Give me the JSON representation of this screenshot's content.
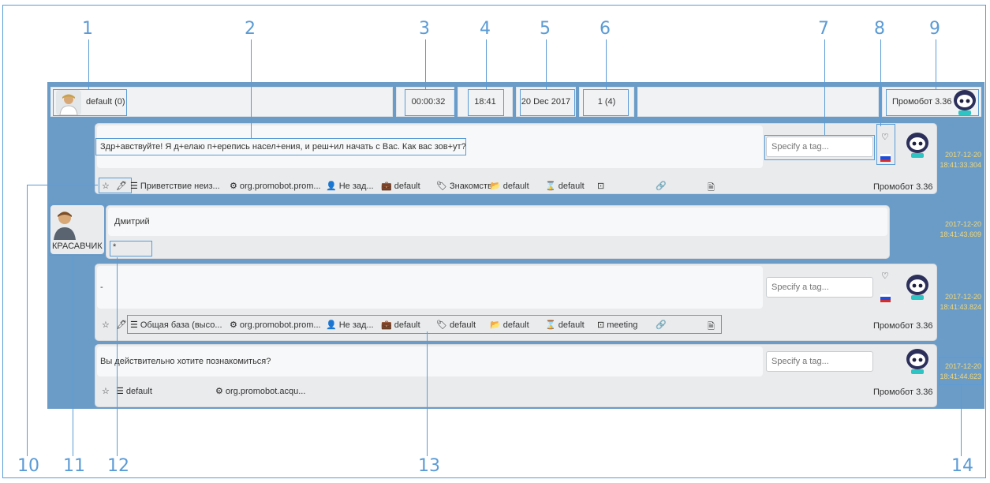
{
  "callouts": [
    "1",
    "2",
    "3",
    "4",
    "5",
    "6",
    "7",
    "8",
    "9",
    "10",
    "11",
    "12",
    "13",
    "14"
  ],
  "topbar": {
    "user_label": "default (0)",
    "timer": "00:00:32",
    "time": "18:41",
    "date": "20 Dec 2017",
    "counter": "1 (4)",
    "bot_name": "Промобот 3.36"
  },
  "messages": [
    {
      "text": "Здр+авствуйте! Я д+елаю п+ерепись насел+ения, и реш+ил начать с Вас. Как вас зов+ут?",
      "tag_placeholder": "Specify a tag...",
      "author": "Промобот 3.36",
      "date": "2017-12-20",
      "time": "18:41:33.304",
      "tools": {
        "category": "Приветствие неиз...",
        "plugin": "org.promobot.prom...",
        "person": "Не зад...",
        "bag": "default",
        "tag": "Знакомств",
        "folder": "default",
        "timer": "default",
        "file": ""
      }
    },
    {
      "name": "Дмитрий",
      "user_label": "КРАСАВЧИК",
      "text": "*",
      "date": "2017-12-20",
      "time": "18:41:43.609"
    },
    {
      "text": "-",
      "tag_placeholder": "Specify a tag...",
      "author": "Промобот 3.36",
      "date": "2017-12-20",
      "time": "18:41:43.824",
      "tools": {
        "category": "Общая база (высо...",
        "plugin": "org.promobot.prom...",
        "person": "Не зад...",
        "bag": "default",
        "tag": "default",
        "folder": "default",
        "timer": "default",
        "meeting": "meeting"
      }
    },
    {
      "text": "Вы действительно хотите познакомиться?",
      "tag_placeholder": "Specify a tag...",
      "author": "Промобот 3.36",
      "date": "2017-12-20",
      "time": "18:41:44.623",
      "tools": {
        "category": "default",
        "plugin": "org.promobot.acqu..."
      }
    }
  ],
  "colors": {
    "panel": "#6b9cc8",
    "callout": "#5b9bd5",
    "timestamp": "#f3d774"
  },
  "icons": [
    "star-icon",
    "pencil-icon",
    "list-icon",
    "gear-icon",
    "user-icon",
    "briefcase-icon",
    "tag-icon",
    "folder-icon",
    "hourglass-icon",
    "circle-dot-icon",
    "link-icon",
    "file-icon",
    "heart-icon",
    "russian-flag-icon",
    "robot-avatar-icon",
    "user-avatar-icon"
  ]
}
